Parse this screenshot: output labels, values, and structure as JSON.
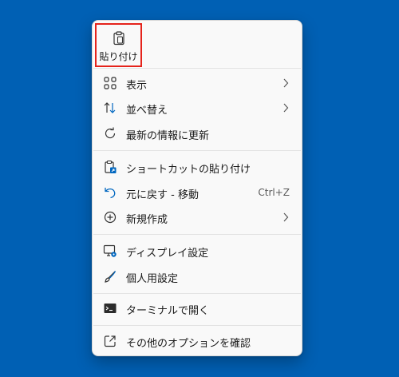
{
  "menu": {
    "paste_label": "貼り付け",
    "items": [
      {
        "label": "表示",
        "icon": "grid-view-icon",
        "submenu": true
      },
      {
        "label": "並べ替え",
        "icon": "sort-icon",
        "submenu": true
      },
      {
        "label": "最新の情報に更新",
        "icon": "refresh-icon",
        "submenu": false
      },
      {
        "label": "ショートカットの貼り付け",
        "icon": "paste-shortcut-icon",
        "submenu": false
      },
      {
        "label": "元に戻す - 移動",
        "icon": "undo-icon",
        "submenu": false,
        "shortcut": "Ctrl+Z"
      },
      {
        "label": "新規作成",
        "icon": "add-circle-icon",
        "submenu": true
      },
      {
        "label": "ディスプレイ設定",
        "icon": "display-settings-icon",
        "submenu": false
      },
      {
        "label": "個人用設定",
        "icon": "brush-icon",
        "submenu": false
      },
      {
        "label": "ターミナルで開く",
        "icon": "terminal-icon",
        "submenu": false
      },
      {
        "label": "その他のオプションを確認",
        "icon": "more-options-icon",
        "submenu": false
      }
    ]
  },
  "colors": {
    "desktop": "#0060b4",
    "menu_bg": "#f9f9f9",
    "highlight_box": "#e5231b",
    "icon_accent": "#0067c0"
  }
}
